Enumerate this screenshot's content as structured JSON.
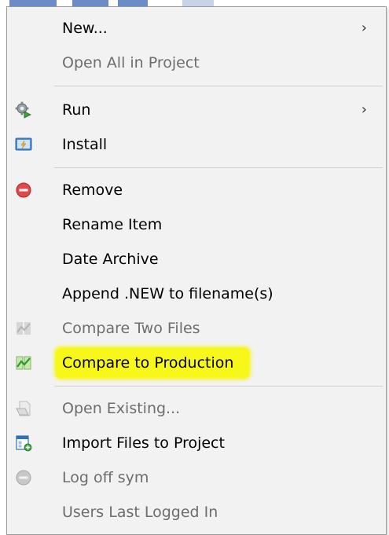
{
  "menu": {
    "items": [
      {
        "label": "New...",
        "icon": "none",
        "submenu": true,
        "disabled": false
      },
      {
        "label": "Open All in Project",
        "icon": "none",
        "submenu": false,
        "disabled": true
      },
      {
        "label": "Run",
        "icon": "gears-run-icon",
        "submenu": true,
        "disabled": false
      },
      {
        "label": "Install",
        "icon": "install-icon",
        "submenu": false,
        "disabled": false
      },
      {
        "label": "Remove",
        "icon": "remove-icon",
        "submenu": false,
        "disabled": false
      },
      {
        "label": "Rename Item",
        "icon": "none",
        "submenu": false,
        "disabled": false
      },
      {
        "label": "Date Archive",
        "icon": "none",
        "submenu": false,
        "disabled": false
      },
      {
        "label": "Append .NEW to filename(s)",
        "icon": "none",
        "submenu": false,
        "disabled": false
      },
      {
        "label": "Compare Two Files",
        "icon": "compare-icon",
        "submenu": false,
        "disabled": true
      },
      {
        "label": "Compare to Production",
        "icon": "compare-icon",
        "submenu": false,
        "disabled": false,
        "highlighted": true
      },
      {
        "label": "Open Existing...",
        "icon": "open-document-icon",
        "submenu": false,
        "disabled": true
      },
      {
        "label": "Import Files to Project",
        "icon": "import-files-icon",
        "submenu": false,
        "disabled": false
      },
      {
        "label": "Log off sym",
        "icon": "log-off-icon",
        "submenu": false,
        "disabled": true
      },
      {
        "label": "Users Last Logged In",
        "icon": "none",
        "submenu": false,
        "disabled": true
      }
    ],
    "submenu_arrow": "›"
  },
  "colors": {
    "menu_background": "#f2f2f2",
    "highlight": "#f7f71a",
    "disabled_text": "#6d6d6d",
    "remove_red": "#e2474b",
    "compare_green": "#2e9a2e"
  }
}
